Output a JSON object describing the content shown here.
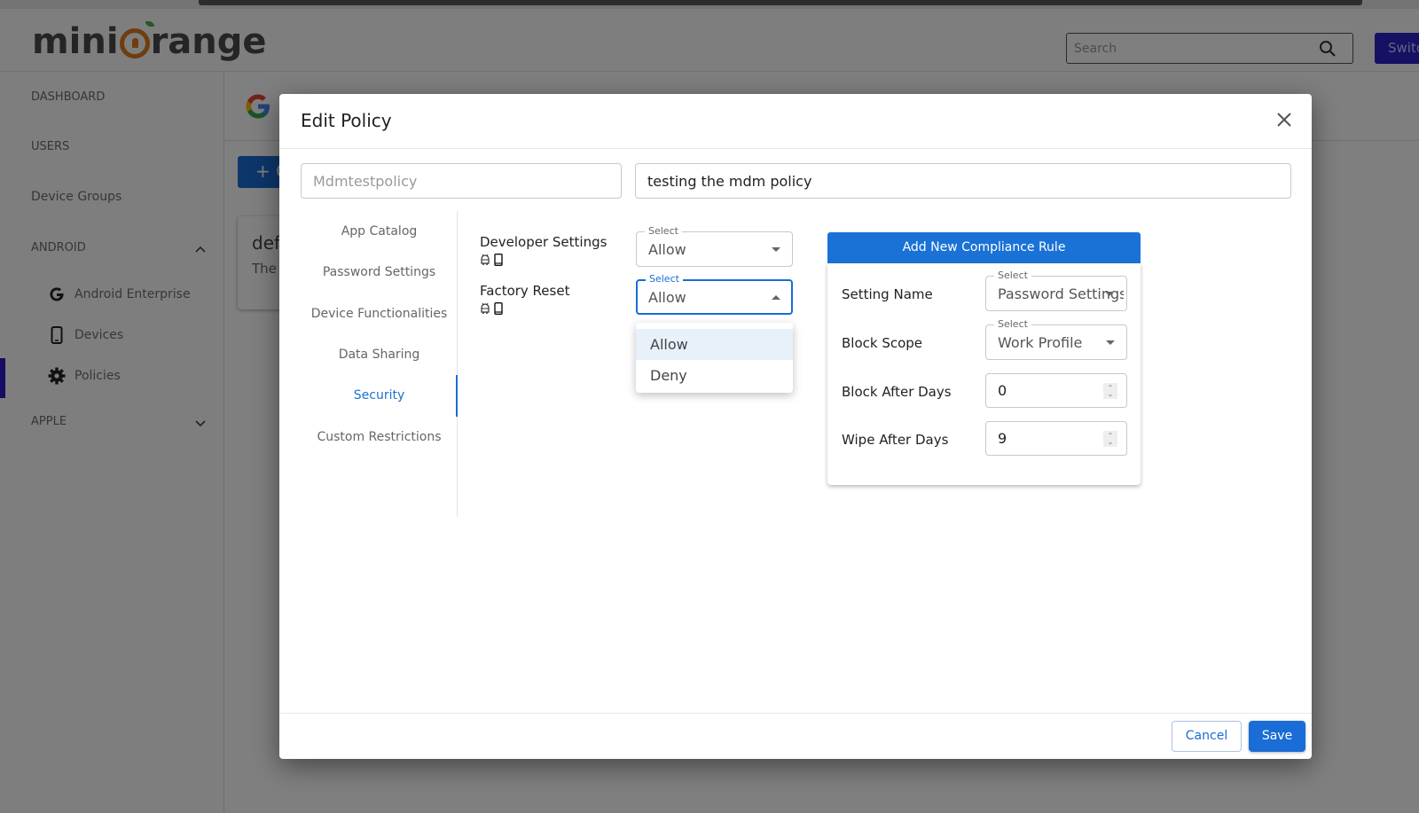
{
  "app": {
    "brand": {
      "prefix": "mini",
      "suffix": "range"
    },
    "search": {
      "placeholder": "Search",
      "value": ""
    },
    "switch_button": "Switc",
    "colors": {
      "brand_orange": "#e07a1c",
      "primary_blue": "#1a6cd6",
      "switch_purple": "#2f23c9"
    }
  },
  "sidebar": {
    "items": [
      {
        "label": "DASHBOARD"
      },
      {
        "label": "USERS"
      },
      {
        "label": "Device Groups"
      },
      {
        "label": "ANDROID",
        "expanded": true
      },
      {
        "label": "APPLE",
        "expanded": false
      }
    ],
    "android_sub": [
      {
        "label": "Android Enterprise",
        "icon": "google-g-icon"
      },
      {
        "label": "Devices",
        "icon": "phone-icon"
      },
      {
        "label": "Policies",
        "icon": "gear-icon",
        "active": true
      }
    ]
  },
  "background": {
    "create_button": "+ C",
    "policy_card": {
      "title": "def",
      "desc": "The"
    }
  },
  "modal": {
    "title": "Edit Policy",
    "policy_name": {
      "value": "",
      "placeholder": "Mdmtestpolicy"
    },
    "policy_description": {
      "value": "testing the mdm policy"
    },
    "tabs": [
      {
        "label": "App Catalog"
      },
      {
        "label": "Password Settings"
      },
      {
        "label": "Device Functionalities"
      },
      {
        "label": "Data Sharing"
      },
      {
        "label": "Security",
        "active": true
      },
      {
        "label": "Custom Restrictions"
      }
    ],
    "settings": [
      {
        "label": "Developer Settings",
        "select_label": "Select",
        "value": "Allow"
      },
      {
        "label": "Factory Reset",
        "select_label": "Select",
        "value": "Allow",
        "open": true
      }
    ],
    "dropdown_options": [
      {
        "label": "Allow",
        "selected": true
      },
      {
        "label": "Deny"
      }
    ],
    "compliance": {
      "button": "Add New Compliance Rule",
      "setting_name": {
        "label": "Setting Name",
        "select_label": "Select",
        "value": "Password Settings"
      },
      "block_scope": {
        "label": "Block Scope",
        "select_label": "Select",
        "value": "Work Profile"
      },
      "block_after_days": {
        "label": "Block After Days",
        "value": "0"
      },
      "wipe_after_days": {
        "label": "Wipe After Days",
        "value": "9"
      }
    },
    "footer": {
      "cancel": "Cancel",
      "save": "Save"
    }
  }
}
